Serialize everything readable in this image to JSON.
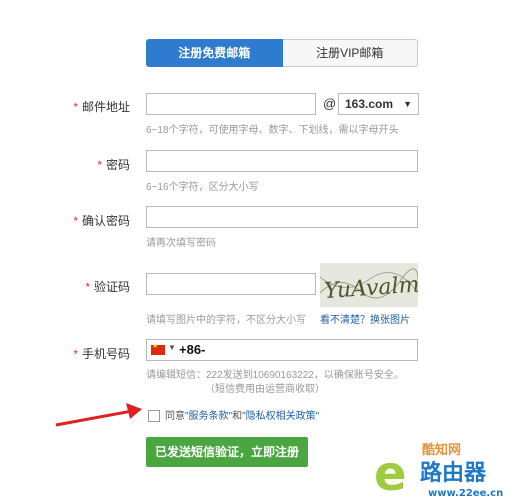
{
  "tabs": {
    "free": "注册免费邮箱",
    "vip": "注册VIP邮箱"
  },
  "form": {
    "email": {
      "label": "邮件地址",
      "at": "@",
      "domain": "163.com",
      "hint": "6~18个字符，可使用字母、数字、下划线，需以字母开头"
    },
    "password": {
      "label": "密码",
      "hint": "6~16个字符，区分大小写"
    },
    "confirm": {
      "label": "确认密码",
      "hint": "请再次填写密码"
    },
    "captcha": {
      "label": "验证码",
      "hint": "请填写图片中的字符，不区分大小写",
      "refresh_link": "看不清楚？换张图片",
      "image_text": "YuAvalmb"
    },
    "phone": {
      "label": "手机号码",
      "prefix": "+86-",
      "hint_line1": "请编辑短信：222发送到10690163222，以确保账号安全。",
      "hint_line2": "（短信费用由运营商收取）"
    },
    "agree": {
      "prefix": "同意",
      "terms": "\"服务条款\"",
      "and": "和",
      "privacy": "\"隐私权相关政策\""
    },
    "submit_label": "已发送短信验证，立即注册",
    "required_mark": "*"
  },
  "watermark": {
    "brand": "酷知网",
    "router": "路由器",
    "url": "www.22ee.cn"
  },
  "colors": {
    "primary": "#2e7bd0",
    "submit": "#4aa63f",
    "required": "#e0322b",
    "link": "#1e5fa8",
    "arrow": "#e02020"
  }
}
